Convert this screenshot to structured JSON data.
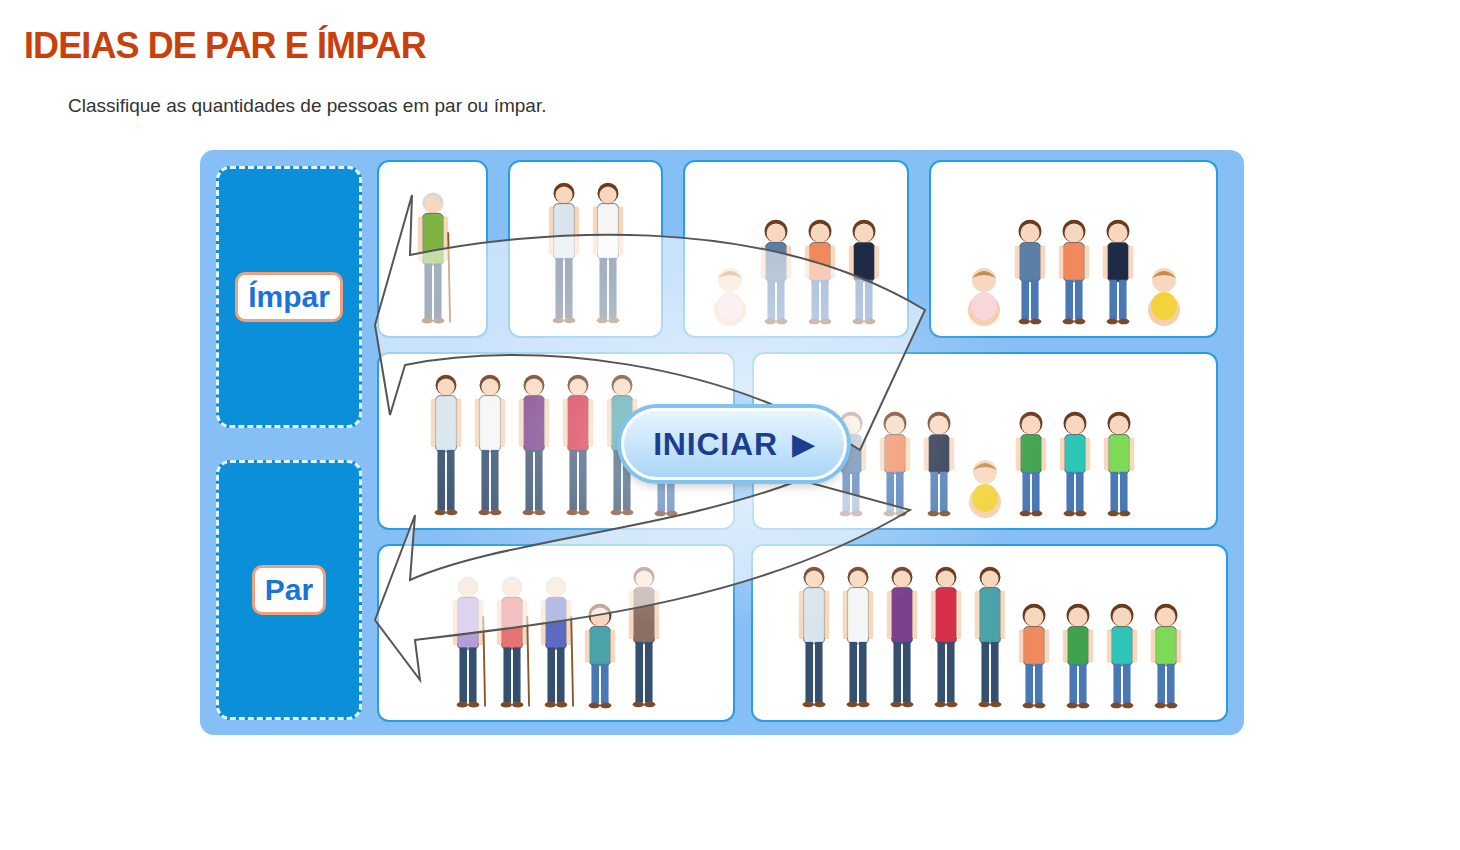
{
  "title": "IDEIAS DE PAR E ÍMPAR",
  "instruction": "Classifique as quantidades de pessoas em par ou ímpar.",
  "targets": [
    {
      "label": "Ímpar"
    },
    {
      "label": "Par"
    }
  ],
  "cards": [
    {
      "people": [
        {
          "kind": "elder",
          "color": "#7cb342"
        }
      ]
    },
    {
      "people": [
        {
          "kind": "adult",
          "color": "#d9e4ec"
        },
        {
          "kind": "adult",
          "color": "#f5f5f5"
        }
      ]
    },
    {
      "people": [
        {
          "kind": "baby",
          "color": "#f8d7dc"
        },
        {
          "kind": "child",
          "color": "#5b7fa6"
        },
        {
          "kind": "child",
          "color": "#f08a5d"
        },
        {
          "kind": "child",
          "color": "#1f2a44"
        }
      ]
    },
    {
      "people": [
        {
          "kind": "baby",
          "color": "#f8d7dc"
        },
        {
          "kind": "child",
          "color": "#5b7fa6"
        },
        {
          "kind": "child",
          "color": "#f08a5d"
        },
        {
          "kind": "child",
          "color": "#1f2a44"
        },
        {
          "kind": "baby",
          "color": "#f3d23a"
        }
      ]
    },
    {
      "people": [
        {
          "kind": "adult",
          "color": "#d9e4ec"
        },
        {
          "kind": "adult",
          "color": "#f5f5f5"
        },
        {
          "kind": "adult",
          "color": "#7b3f8c"
        },
        {
          "kind": "adult",
          "color": "#d6304a"
        },
        {
          "kind": "adult",
          "color": "#4aa3a8"
        },
        {
          "kind": "child",
          "color": "#f08a5d"
        }
      ]
    },
    {
      "people": [
        {
          "kind": "child",
          "color": "#5b7fa6"
        },
        {
          "kind": "child",
          "color": "#f08a5d"
        },
        {
          "kind": "child",
          "color": "#1f2a44"
        },
        {
          "kind": "baby",
          "color": "#f3d23a"
        },
        {
          "kind": "child",
          "color": "#3fa34d"
        },
        {
          "kind": "child",
          "color": "#2ec4b6"
        },
        {
          "kind": "child",
          "color": "#7ed957"
        }
      ]
    },
    {
      "people": [
        {
          "kind": "elder",
          "color": "#b39ddb"
        },
        {
          "kind": "elder",
          "color": "#e57373"
        },
        {
          "kind": "elder",
          "color": "#5c6bc0"
        },
        {
          "kind": "child",
          "color": "#4aa3a8"
        },
        {
          "kind": "adult",
          "color": "#8d6e63"
        }
      ]
    },
    {
      "people": [
        {
          "kind": "adult",
          "color": "#d9e4ec"
        },
        {
          "kind": "adult",
          "color": "#f5f5f5"
        },
        {
          "kind": "adult",
          "color": "#7b3f8c"
        },
        {
          "kind": "adult",
          "color": "#d6304a"
        },
        {
          "kind": "adult",
          "color": "#4aa3a8"
        },
        {
          "kind": "child",
          "color": "#f08a5d"
        },
        {
          "kind": "child",
          "color": "#3fa34d"
        },
        {
          "kind": "child",
          "color": "#2ec4b6"
        },
        {
          "kind": "child",
          "color": "#7ed957"
        }
      ]
    }
  ],
  "start_button": {
    "label": "INICIAR",
    "icon": "▶"
  }
}
